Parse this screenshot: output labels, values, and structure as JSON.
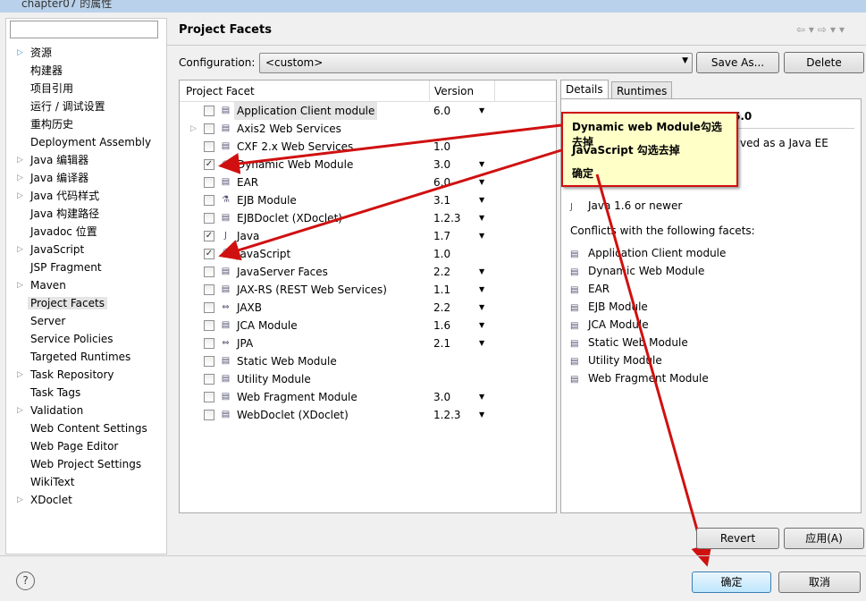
{
  "window": {
    "title": "chapter07 的属性"
  },
  "sidebar": {
    "filter_value": "",
    "items": [
      {
        "label": "资源",
        "exp": true
      },
      {
        "label": "构建器",
        "exp": false
      },
      {
        "label": "项目引用",
        "exp": false
      },
      {
        "label": "运行 / 调试设置",
        "exp": false
      },
      {
        "label": "重构历史",
        "exp": false
      },
      {
        "label": "Deployment Assembly",
        "exp": false
      },
      {
        "label": "Java 编辑器",
        "exp": true
      },
      {
        "label": "Java 编译器",
        "exp": true
      },
      {
        "label": "Java 代码样式",
        "exp": true
      },
      {
        "label": "Java 构建路径",
        "exp": false
      },
      {
        "label": "Javadoc 位置",
        "exp": false
      },
      {
        "label": "JavaScript",
        "exp": true
      },
      {
        "label": "JSP Fragment",
        "exp": false
      },
      {
        "label": "Maven",
        "exp": true
      },
      {
        "label": "Project Facets",
        "exp": false,
        "selected": true
      },
      {
        "label": "Server",
        "exp": false
      },
      {
        "label": "Service Policies",
        "exp": false
      },
      {
        "label": "Targeted Runtimes",
        "exp": false
      },
      {
        "label": "Task Repository",
        "exp": true
      },
      {
        "label": "Task Tags",
        "exp": false
      },
      {
        "label": "Validation",
        "exp": true
      },
      {
        "label": "Web Content Settings",
        "exp": false
      },
      {
        "label": "Web Page Editor",
        "exp": false
      },
      {
        "label": "Web Project Settings",
        "exp": false
      },
      {
        "label": "WikiText",
        "exp": false
      },
      {
        "label": "XDoclet",
        "exp": true
      }
    ]
  },
  "main": {
    "title": "Project Facets",
    "configuration_label": "Configuration:",
    "configuration_value": "<custom>",
    "save_as": "Save As...",
    "delete": "Delete"
  },
  "facets": {
    "col_facet": "Project Facet",
    "col_version": "Version",
    "rows": [
      {
        "name": "Application Client module",
        "version": "6.0",
        "checked": false,
        "dd": true,
        "icon": "page",
        "selected": true
      },
      {
        "name": "Axis2 Web Services",
        "version": "",
        "checked": false,
        "dd": false,
        "icon": "page",
        "expander": true
      },
      {
        "name": "CXF 2.x Web Services",
        "version": "1.0",
        "checked": false,
        "dd": false,
        "icon": "page"
      },
      {
        "name": "Dynamic Web Module",
        "version": "3.0",
        "checked": true,
        "dd": true,
        "icon": "globe"
      },
      {
        "name": "EAR",
        "version": "6.0",
        "checked": false,
        "dd": true,
        "icon": "page"
      },
      {
        "name": "EJB Module",
        "version": "3.1",
        "checked": false,
        "dd": true,
        "icon": "bean"
      },
      {
        "name": "EJBDoclet (XDoclet)",
        "version": "1.2.3",
        "checked": false,
        "dd": true,
        "icon": "page"
      },
      {
        "name": "Java",
        "version": "1.7",
        "checked": true,
        "dd": true,
        "icon": "java"
      },
      {
        "name": "JavaScript",
        "version": "1.0",
        "checked": true,
        "dd": false,
        "icon": "lock"
      },
      {
        "name": "JavaServer Faces",
        "version": "2.2",
        "checked": false,
        "dd": true,
        "icon": "page"
      },
      {
        "name": "JAX-RS (REST Web Services)",
        "version": "1.1",
        "checked": false,
        "dd": true,
        "icon": "page"
      },
      {
        "name": "JAXB",
        "version": "2.2",
        "checked": false,
        "dd": true,
        "icon": "arrows"
      },
      {
        "name": "JCA Module",
        "version": "1.6",
        "checked": false,
        "dd": true,
        "icon": "page"
      },
      {
        "name": "JPA",
        "version": "2.1",
        "checked": false,
        "dd": true,
        "icon": "arrows"
      },
      {
        "name": "Static Web Module",
        "version": "",
        "checked": false,
        "dd": false,
        "icon": "page"
      },
      {
        "name": "Utility Module",
        "version": "",
        "checked": false,
        "dd": false,
        "icon": "page"
      },
      {
        "name": "Web Fragment Module",
        "version": "3.0",
        "checked": false,
        "dd": true,
        "icon": "page"
      },
      {
        "name": "WebDoclet (XDoclet)",
        "version": "1.2.3",
        "checked": false,
        "dd": true,
        "icon": "page"
      }
    ]
  },
  "details": {
    "tabs": [
      "Details",
      "Runtimes"
    ],
    "header_fragment": "6.0",
    "desc_fragment": "ved as a Java EE",
    "requires_item": "Java 1.6 or newer",
    "conflicts_label": "Conflicts with the following facets:",
    "conflicts": [
      "Application Client module",
      "Dynamic Web Module",
      "EAR",
      "EJB Module",
      "JCA Module",
      "Static Web Module",
      "Utility Module",
      "Web Fragment Module"
    ]
  },
  "annotation": {
    "lines": [
      "Dynamic web Module勾选去掉",
      "JavaScript 勾选去掉",
      "确定"
    ],
    "color": "#d01010"
  },
  "buttons": {
    "revert": "Revert",
    "apply": "应用(A)",
    "ok": "确定",
    "cancel": "取消",
    "help": "?"
  }
}
